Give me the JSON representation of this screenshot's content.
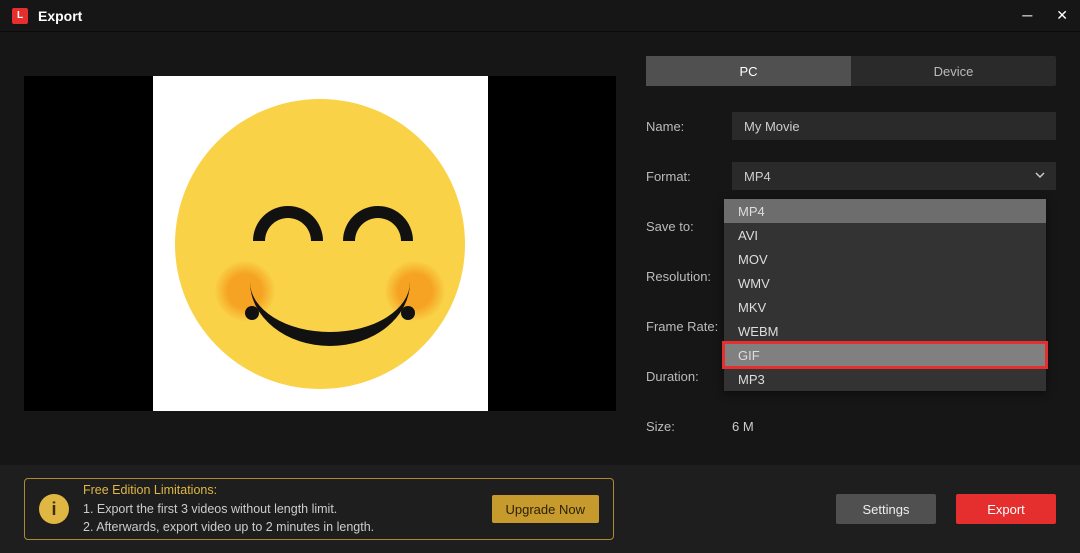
{
  "window": {
    "title": "Export"
  },
  "tabs": {
    "pc": "PC",
    "device": "Device"
  },
  "labels": {
    "name": "Name:",
    "format": "Format:",
    "saveTo": "Save to:",
    "resolution": "Resolution:",
    "frameRate": "Frame Rate:",
    "duration": "Duration:",
    "size": "Size:"
  },
  "fields": {
    "name": "My Movie",
    "format": "MP4",
    "size": "6 M"
  },
  "formatOptions": [
    "MP4",
    "AVI",
    "MOV",
    "WMV",
    "MKV",
    "WEBM",
    "GIF",
    "MP3"
  ],
  "limitations": {
    "title": "Free Edition Limitations:",
    "line1": "1. Export the first 3 videos without length limit.",
    "line2": "2. Afterwards, export video up to 2 minutes in length.",
    "upgrade": "Upgrade Now"
  },
  "buttons": {
    "settings": "Settings",
    "export": "Export"
  }
}
